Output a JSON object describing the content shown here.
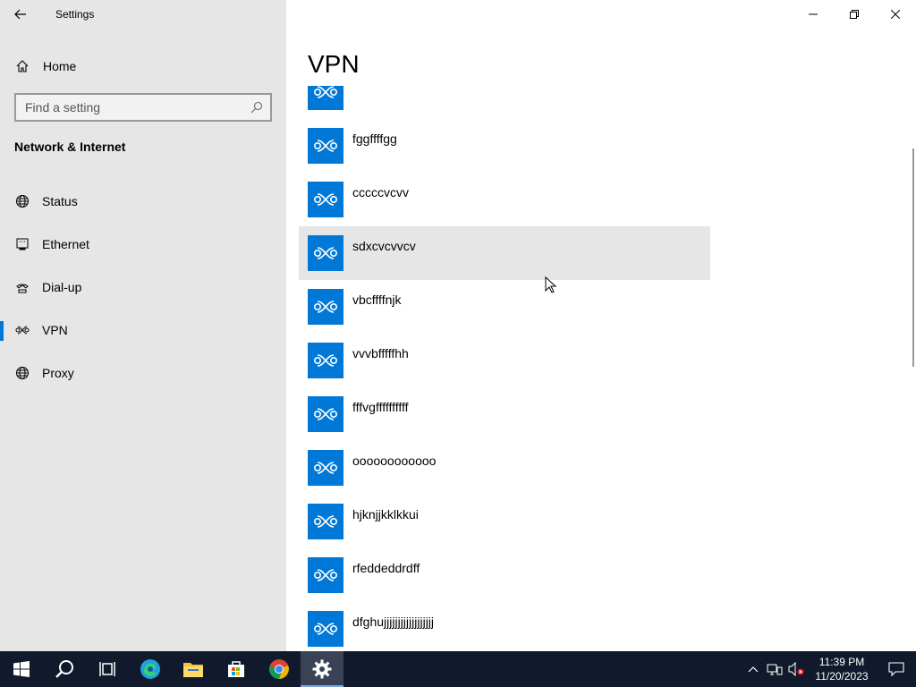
{
  "window": {
    "title": "Settings",
    "back_label": "Back",
    "minimize": "Minimize",
    "maximize": "Restore",
    "close": "Close"
  },
  "sidebar": {
    "home_label": "Home",
    "search_placeholder": "Find a setting",
    "section_title": "Network & Internet",
    "items": [
      {
        "label": "Status",
        "icon": "globe-icon"
      },
      {
        "label": "Ethernet",
        "icon": "ethernet-icon"
      },
      {
        "label": "Dial-up",
        "icon": "dialup-icon"
      },
      {
        "label": "VPN",
        "icon": "vpn-icon",
        "active": true
      },
      {
        "label": "Proxy",
        "icon": "globe-icon"
      }
    ]
  },
  "main": {
    "title": "VPN",
    "connections": [
      {
        "name": ""
      },
      {
        "name": "fggffffgg"
      },
      {
        "name": "cccccvcvv"
      },
      {
        "name": "sdxcvcvvcv"
      },
      {
        "name": "vbcffffnjk"
      },
      {
        "name": "vvvbfffffhh"
      },
      {
        "name": "fffvgffffffffff"
      },
      {
        "name": "oooooooooooo"
      },
      {
        "name": "hjknjjkklkkui"
      },
      {
        "name": "rfeddeddrdff"
      },
      {
        "name": "dfghujjjjjjjjjjjjjjjjjj"
      }
    ],
    "hovered_index": 3
  },
  "taskbar": {
    "apps": [
      "start",
      "search",
      "task-view",
      "edge",
      "file-explorer",
      "store",
      "chrome",
      "settings"
    ],
    "active_app": "settings",
    "time": "11:39 PM",
    "date": "11/20/2023"
  },
  "colors": {
    "accent": "#0078d7",
    "sidebar_bg": "#e6e6e6",
    "taskbar_bg": "#101a2c"
  }
}
